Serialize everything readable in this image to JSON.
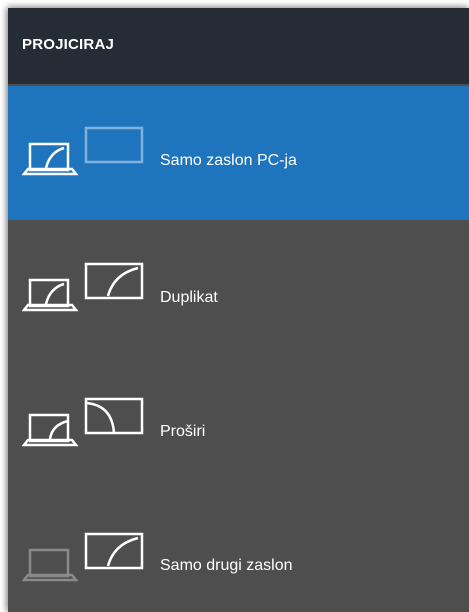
{
  "header": {
    "title": "PROJICIRAJ"
  },
  "options": [
    {
      "label": "Samo zaslon PC-ja",
      "icon": "pc-screen-only-icon",
      "selected": true
    },
    {
      "label": "Duplikat",
      "icon": "duplicate-icon",
      "selected": false
    },
    {
      "label": "Proširi",
      "icon": "extend-icon",
      "selected": false
    },
    {
      "label": "Samo drugi zaslon",
      "icon": "second-screen-only-icon",
      "selected": false
    }
  ],
  "colors": {
    "panel_bg": "#4e4e4e",
    "header_bg": "#262c36",
    "selected_bg": "#1e74bd",
    "text": "#ffffff",
    "dimmed_icon": "#8a8a8a"
  }
}
